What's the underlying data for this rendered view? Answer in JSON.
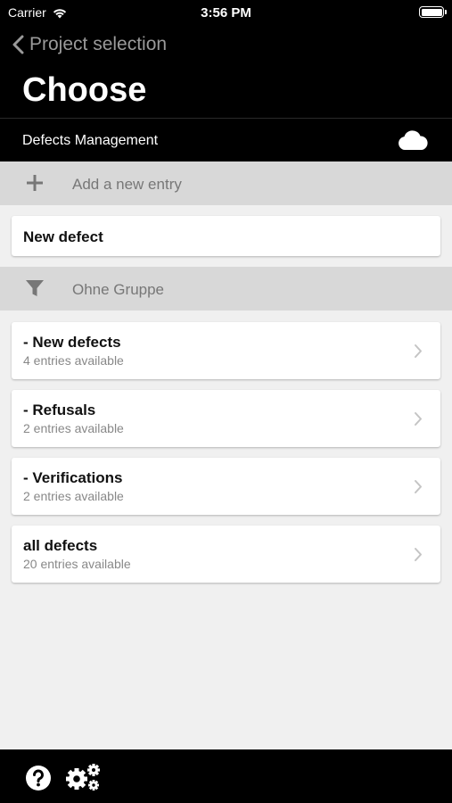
{
  "status_bar": {
    "carrier": "Carrier",
    "time": "3:56 PM"
  },
  "nav": {
    "back_label": "Project selection",
    "title": "Choose"
  },
  "module_bar": {
    "label": "Defects Management",
    "icon": "cloud-icon"
  },
  "add_entry": {
    "label": "Add a new entry",
    "icon": "plus-icon"
  },
  "new_defect": {
    "label": "New defect"
  },
  "group_filter": {
    "label": "Ohne Gruppe",
    "icon": "filter-icon"
  },
  "lists": [
    {
      "title": "- New defects",
      "subtitle": "4 entries available"
    },
    {
      "title": "- Refusals",
      "subtitle": "2 entries available"
    },
    {
      "title": "- Verifications",
      "subtitle": "2 entries available"
    },
    {
      "title": "all defects",
      "subtitle": "20 entries available"
    }
  ],
  "tabbar": {
    "help_icon": "help-icon",
    "settings_icon": "gears-icon"
  },
  "colors": {
    "bar_bg": "#000000",
    "section_bg": "#d8d8d8",
    "page_bg": "#f0f0f0",
    "muted_text": "#777777"
  }
}
